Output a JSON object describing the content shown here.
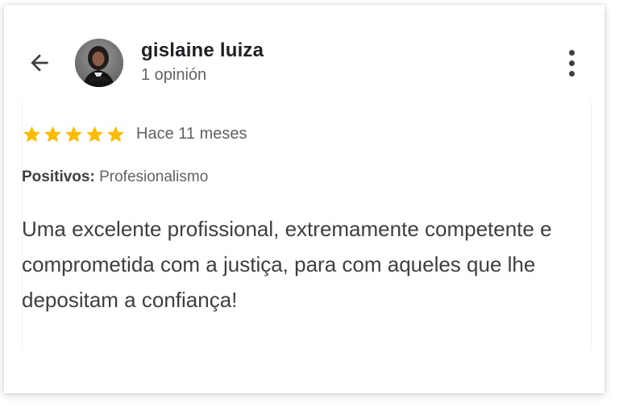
{
  "reviewer": {
    "name": "gislaine luiza",
    "review_count": "1 opinión"
  },
  "review": {
    "rating": 5,
    "rating_max": 5,
    "time_ago": "Hace 11 meses",
    "positives_label": "Positivos:",
    "positives_value": "Profesionalismo",
    "text": "Uma excelente profissional, extremamente competente e comprometida com a justiça, para com aqueles que lhe depositam a confiança!"
  },
  "icons": {
    "back": "arrow-back-icon",
    "more": "more-vert-icon",
    "star": "star-icon"
  },
  "colors": {
    "star": "#fbbc04",
    "text_primary": "#202124",
    "text_secondary": "#5f6368"
  }
}
